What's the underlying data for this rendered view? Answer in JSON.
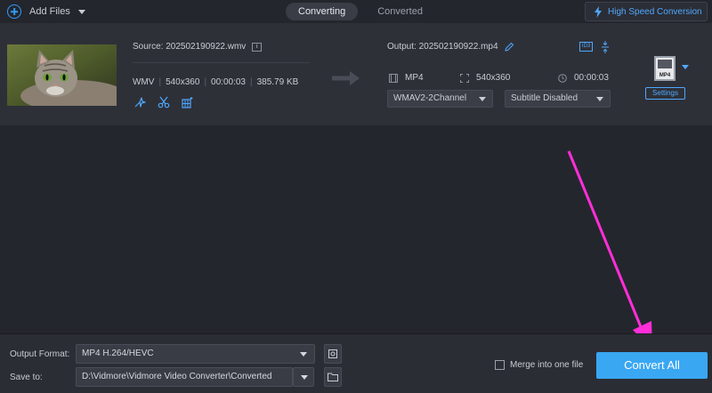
{
  "toolbar": {
    "add_files_label": "Add Files",
    "add_icon": "plus-circle-icon",
    "tabs": [
      {
        "label": "Converting",
        "active": true
      },
      {
        "label": "Converted",
        "active": false
      }
    ],
    "high_speed_label": "High Speed Conversion",
    "accent_color": "#4fa8ff"
  },
  "file": {
    "source_label": "Source: 202502190922.wmv",
    "info_icon_text": "i",
    "format": "WMV",
    "resolution": "540x360",
    "duration": "00:00:03",
    "size": "385.79 KB",
    "output_label": "Output: 202502190922.mp4",
    "id3_label": "ID3",
    "out_format": "MP4",
    "out_resolution": "540x360",
    "out_duration": "00:00:03",
    "audio_track": "WMAV2-2Channel",
    "subtitle": "Subtitle Disabled",
    "format_badge": "MP4",
    "settings_label": "Settings"
  },
  "bottom": {
    "output_format_label": "Output Format:",
    "output_format_value": "MP4 H.264/HEVC",
    "save_to_label": "Save to:",
    "save_to_value": "D:\\Vidmore\\Vidmore Video Converter\\Converted",
    "merge_label": "Merge into one file",
    "convert_label": "Convert All",
    "convert_color": "#3aa7f3"
  },
  "annotation_color": "#ff2ed8"
}
